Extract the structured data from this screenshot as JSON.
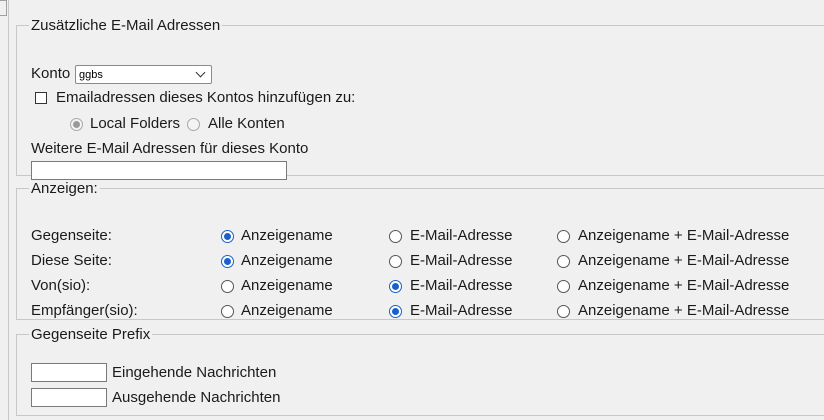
{
  "zusaetzliche": {
    "legend": "Zusätzliche E-Mail Adressen",
    "konto_label": "Konto",
    "konto_selected": "ggbs",
    "add_checkbox_label": "Emailadressen dieses Kontos hinzufügen zu:",
    "add_checked": false,
    "targets": [
      {
        "label": "Local Folders",
        "checked": true
      },
      {
        "label": "Alle Konten",
        "checked": false
      }
    ],
    "weitere_label": "Weitere E-Mail Adressen für dieses Konto",
    "weitere_value": ""
  },
  "anzeigen": {
    "legend": "Anzeigen:",
    "options": [
      "Anzeigename",
      "E-Mail-Adresse",
      "Anzeigename + E-Mail-Adresse"
    ],
    "rows": [
      {
        "label": "Gegenseite:",
        "selected": 0
      },
      {
        "label": "Diese Seite:",
        "selected": 0
      },
      {
        "label": "Von(sio):",
        "selected": 1
      },
      {
        "label": "Empfänger(sio):",
        "selected": 1
      }
    ]
  },
  "prefix": {
    "legend": "Gegenseite Prefix",
    "incoming_label": "Eingehende Nachrichten",
    "incoming_value": "",
    "outgoing_label": "Ausgehende Nachrichten",
    "outgoing_value": ""
  },
  "colors": {
    "accent": "#1a5fcc",
    "background": "#f0f0f0",
    "border": "#c8c8c8"
  }
}
